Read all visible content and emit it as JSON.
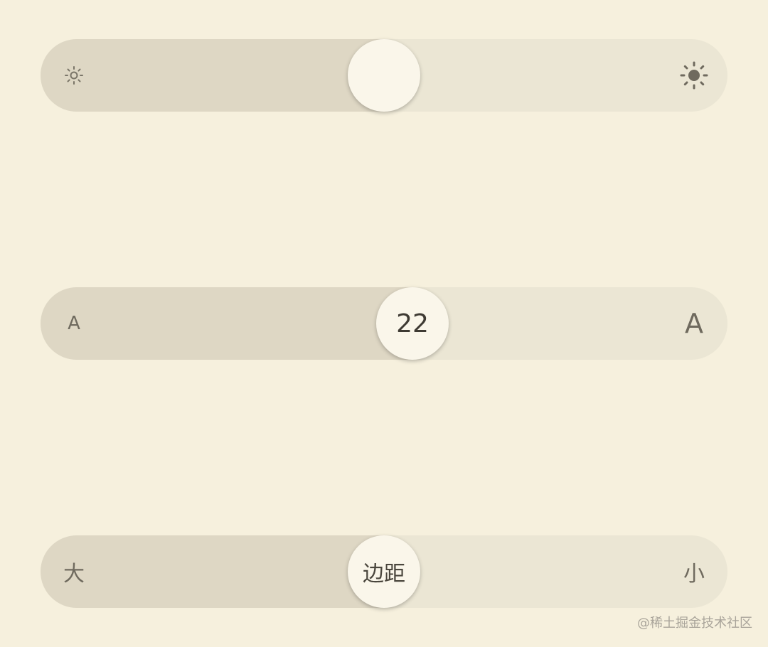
{
  "brightness": {
    "level_percent": 50,
    "min_icon": "sun-small-icon",
    "max_icon": "sun-large-icon",
    "knob_icon": "none"
  },
  "font_size": {
    "value": "22",
    "level_percent": 54,
    "min_label": "A",
    "max_label": "A"
  },
  "margin": {
    "knob_label": "边距",
    "level_percent": 50,
    "left_label": "大",
    "right_label": "小"
  },
  "watermark": {
    "text": "@稀土掘金技术社区"
  },
  "colors": {
    "background": "#f6f0dd",
    "track": "#ebe6d4",
    "fill": "#ded7c4",
    "knob": "#faf6ea"
  }
}
